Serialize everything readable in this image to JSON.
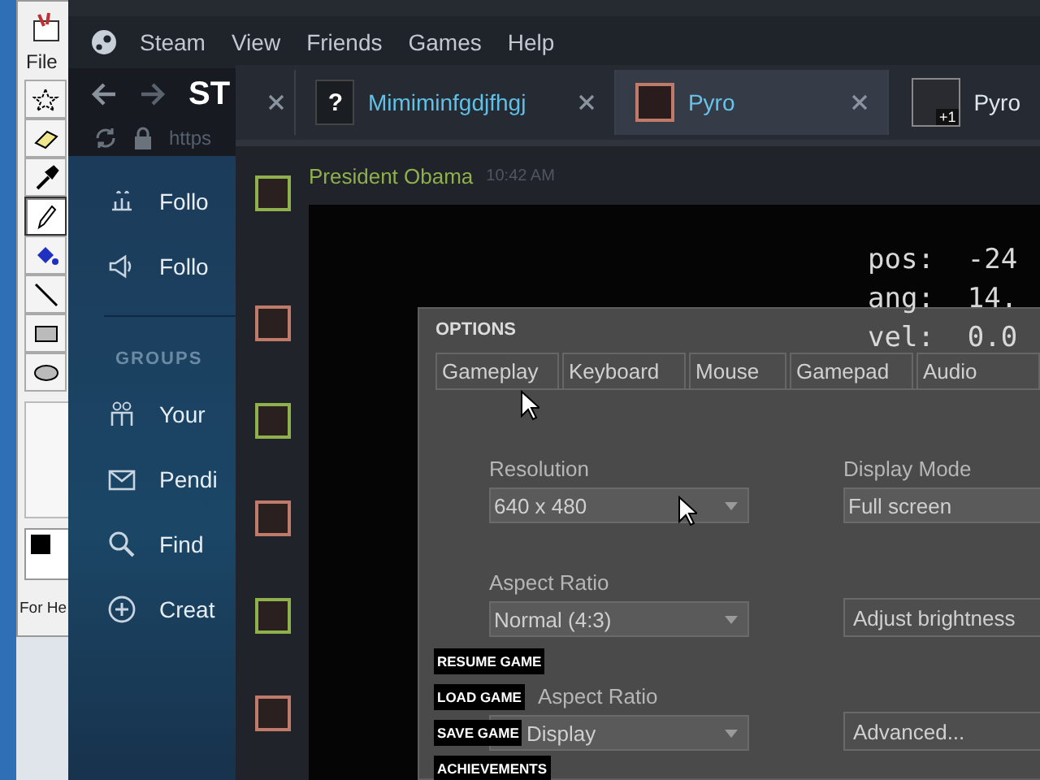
{
  "paint": {
    "menu": "File",
    "tools": [
      {
        "kind": "select",
        "selected": false
      },
      {
        "kind": "eraser",
        "selected": false
      },
      {
        "kind": "picker",
        "selected": false
      },
      {
        "kind": "pencil",
        "selected": true
      },
      {
        "kind": "fill",
        "selected": false
      },
      {
        "kind": "line",
        "selected": false
      },
      {
        "kind": "rect",
        "selected": false
      },
      {
        "kind": "ellipse",
        "selected": false
      }
    ],
    "status": "For He"
  },
  "steam": {
    "menu": [
      "Steam",
      "View",
      "Friends",
      "Games",
      "Help"
    ],
    "title": "ST",
    "url": "https",
    "sidebar": {
      "items": [
        {
          "kind": "follow",
          "label": "Follo"
        },
        {
          "kind": "announce",
          "label": "Follo"
        }
      ],
      "section": "GROUPS",
      "group_items": [
        {
          "kind": "groups",
          "label": "Your"
        },
        {
          "kind": "mail",
          "label": "Pendi"
        },
        {
          "kind": "search",
          "label": "Find"
        },
        {
          "kind": "add",
          "label": "Creat"
        }
      ]
    }
  },
  "chat": {
    "tabs": [
      {
        "kind": "cut",
        "selected": false,
        "closable": true
      },
      {
        "kind": "unknown",
        "icon": "?",
        "label": "Mimiminfgdjfhgj",
        "selected": false,
        "closable": true
      },
      {
        "kind": "avatar",
        "label": "Pyro",
        "selected": true,
        "closable": true
      },
      {
        "kind": "group",
        "badge": "+1",
        "label": "Pyro",
        "selected": false,
        "closable": false
      }
    ],
    "message": {
      "sender": "President Obama",
      "time": "10:42 AM",
      "color": "#8fb04a"
    },
    "avatars": [
      {
        "color": "#c07a6a"
      },
      {
        "color": "#8fb04a"
      },
      {
        "color": "#c07a6a"
      },
      {
        "color": "#8fb04a"
      },
      {
        "color": "#c07a6a"
      }
    ]
  },
  "game": {
    "debug": [
      "pos:  -24",
      "ang:  14.",
      "vel:  0.0"
    ],
    "menu": [
      "RESUME GAME",
      "LOAD GAME",
      "SAVE GAME",
      "ACHIEVEMENTS"
    ]
  },
  "options": {
    "title": "OPTIONS",
    "tabs": [
      {
        "label": "Gameplay",
        "selected": false
      },
      {
        "label": "Keyboard",
        "selected": false
      },
      {
        "label": "Mouse",
        "selected": false
      },
      {
        "label": "Gamepad",
        "selected": false
      },
      {
        "label": "Audio",
        "selected": false
      }
    ],
    "fields": [
      {
        "kind": "select",
        "label": "Resolution",
        "value": "640 x 480"
      },
      {
        "kind": "select",
        "label": "Display Mode",
        "value": "Full screen"
      },
      {
        "kind": "select",
        "label": "Aspect Ratio",
        "value": "Normal (4:3)"
      },
      {
        "kind": "button",
        "value": "Adjust brightness"
      },
      {
        "kind": "select",
        "label": "Aspect Ratio",
        "value": "Display"
      },
      {
        "kind": "button",
        "value": "Advanced..."
      }
    ]
  }
}
